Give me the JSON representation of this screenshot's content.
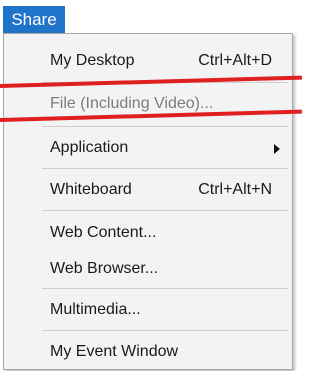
{
  "menubar": {
    "share_label": "Share"
  },
  "menu": {
    "items": [
      {
        "label": "My Desktop",
        "shortcut": "Ctrl+Alt+D"
      },
      {
        "label": "File (Including Video)..."
      },
      {
        "label": "Application"
      },
      {
        "label": "Whiteboard",
        "shortcut": "Ctrl+Alt+N"
      },
      {
        "label": "Web Content..."
      },
      {
        "label": "Web Browser..."
      },
      {
        "label": "Multimedia..."
      },
      {
        "label": "My Event Window"
      }
    ]
  },
  "colors": {
    "menubar_bg": "#1f73c8",
    "menu_bg": "#f3f3f3",
    "highlight": "#e02020"
  }
}
